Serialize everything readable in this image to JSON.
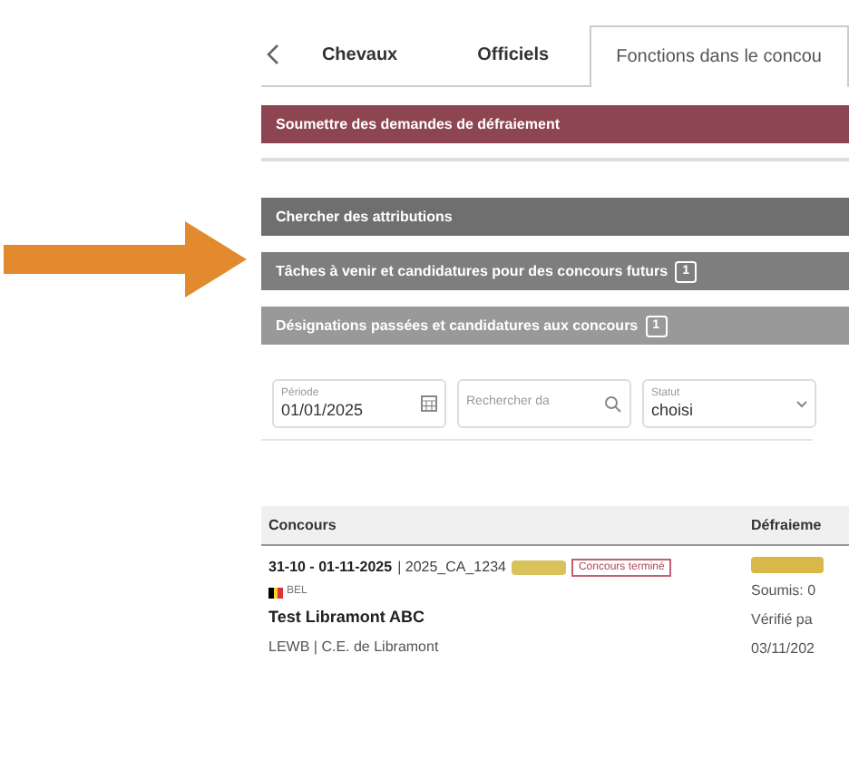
{
  "tabs": [
    {
      "label": "Chevaux",
      "selected": false
    },
    {
      "label": "Officiels",
      "selected": false
    },
    {
      "label": "Fonctions dans le concou",
      "selected": true
    }
  ],
  "sections": [
    {
      "title": "Soumettre des demandes de défraiement",
      "kind": "primary"
    },
    {
      "title": "Chercher des attributions",
      "kind": "dark"
    },
    {
      "title": "Tâches à venir et candidatures pour des concours futurs",
      "kind": "mid",
      "count": "1"
    },
    {
      "title": "Désignations passées et candidatures aux concours",
      "kind": "light",
      "count": "1"
    }
  ],
  "filters": [
    {
      "label": "Période",
      "value": "01/01/2025",
      "kind": "date"
    },
    {
      "placeholder": "Rechercher da",
      "kind": "search"
    },
    {
      "label": "Statut",
      "value": "choisi",
      "kind": "select"
    }
  ],
  "table": {
    "columns": [
      "Concours",
      "Défraieme"
    ],
    "rows": [
      {
        "dates": "31-10 - 01-11-2025",
        "code": "| 2025_CA_1234",
        "tag": "Concours terminé",
        "country": "BEL",
        "name": "Test Libramont ABC",
        "organizer": "LEWB | C.E. de Libramont",
        "expense_lines": [
          "Soumis: 0",
          "Vérifié pa",
          "03/11/202"
        ]
      }
    ]
  }
}
